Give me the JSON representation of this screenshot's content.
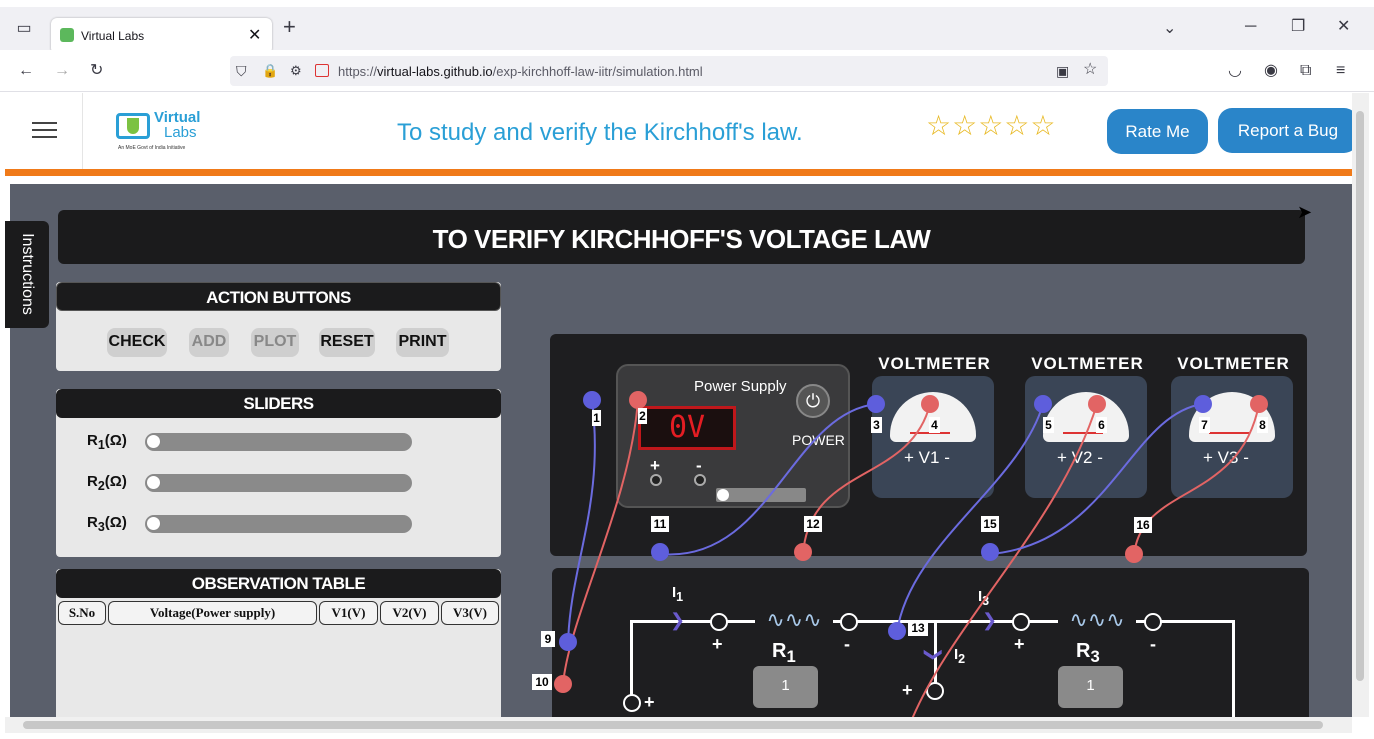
{
  "browser": {
    "tab_title": "Virtual Labs",
    "url_prefix": "https://",
    "url_host": "virtual-labs.github.io",
    "url_path": "/exp-kirchhoff-law-iitr/simulation.html"
  },
  "header": {
    "logo_line1": "Virtual",
    "logo_line2": "Labs",
    "logo_tagline": "An MoE Govt of India Initiative",
    "title": "To study and verify the Kirchhoff's law.",
    "rating_stars": 5,
    "rate_label": "Rate Me",
    "bug_label": "Report a Bug"
  },
  "instructions_tab": "Instructions",
  "main": {
    "heading": "TO VERIFY KIRCHHOFF'S VOLTAGE LAW",
    "actions": {
      "title": "ACTION BUTTONS",
      "check": "CHECK",
      "add": "ADD",
      "plot": "PLOT",
      "reset": "RESET",
      "print": "PRINT"
    },
    "sliders": {
      "title": "SLIDERS",
      "items": [
        {
          "label": "R",
          "sub": "1",
          "unit": "(Ω)"
        },
        {
          "label": "R",
          "sub": "2",
          "unit": "(Ω)"
        },
        {
          "label": "R",
          "sub": "3",
          "unit": "(Ω)"
        }
      ]
    },
    "table": {
      "title": "OBSERVATION TABLE",
      "cols": [
        "S.No",
        "Voltage(Power supply)",
        "V1(V)",
        "V2(V)",
        "V3(V)"
      ]
    },
    "power_supply": {
      "title": "Power Supply",
      "display": "0V",
      "power_label": "POWER",
      "plus": "+",
      "minus": "-"
    },
    "voltmeters": [
      {
        "title": "VOLTMETER",
        "label": "V1",
        "plus": "+",
        "minus": "-"
      },
      {
        "title": "VOLTMETER",
        "label": "V2",
        "plus": "+",
        "minus": "-"
      },
      {
        "title": "VOLTMETER",
        "label": "V3",
        "plus": "+",
        "minus": "-"
      }
    ],
    "terminals": [
      "1",
      "2",
      "3",
      "4",
      "5",
      "6",
      "7",
      "8",
      "9",
      "10",
      "11",
      "12",
      "13",
      "15",
      "16"
    ],
    "circuit": {
      "i1": "I",
      "i1_sub": "1",
      "i2": "I",
      "i2_sub": "2",
      "i3": "I",
      "i3_sub": "3",
      "r1": "R",
      "r1_sub": "1",
      "r3": "R",
      "r3_sub": "3",
      "r1_value": "1",
      "r3_value": "1",
      "plus": "+",
      "minus": "-"
    }
  }
}
